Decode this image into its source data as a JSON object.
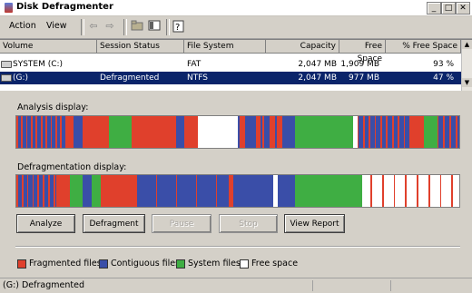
{
  "window": {
    "title": "Disk Defragmenter"
  },
  "menu": {
    "action": "Action",
    "view": "View"
  },
  "columns": [
    "Volume",
    "Session Status",
    "File System",
    "Capacity",
    "Free Space",
    "% Free Space"
  ],
  "volumes": [
    {
      "volume": "SYSTEM (C:)",
      "status": "",
      "fs": "FAT",
      "capacity": "2,047 MB",
      "free": "1,909 MB",
      "pct": "93 %"
    },
    {
      "volume": "(G:)",
      "status": "Defragmented",
      "fs": "NTFS",
      "capacity": "2,047 MB",
      "free": "977 MB",
      "pct": "47 %",
      "selected": true
    }
  ],
  "analysis_label": "Analysis display:",
  "defrag_label": "Defragmentation display:",
  "buttons": {
    "analyze": "Analyze",
    "defragment": "Defragment",
    "pause": "Pause",
    "stop": "Stop",
    "view_report": "View Report"
  },
  "legend": {
    "fragmented": "Fragmented files",
    "contiguous": "Contiguous files",
    "system": "System files",
    "free": "Free space"
  },
  "colors": {
    "fragmented": "#e0402c",
    "contiguous": "#3a4ea8",
    "system": "#3fae43",
    "free": "#ffffff"
  },
  "status": {
    "text": "(G:) Defragmented"
  }
}
